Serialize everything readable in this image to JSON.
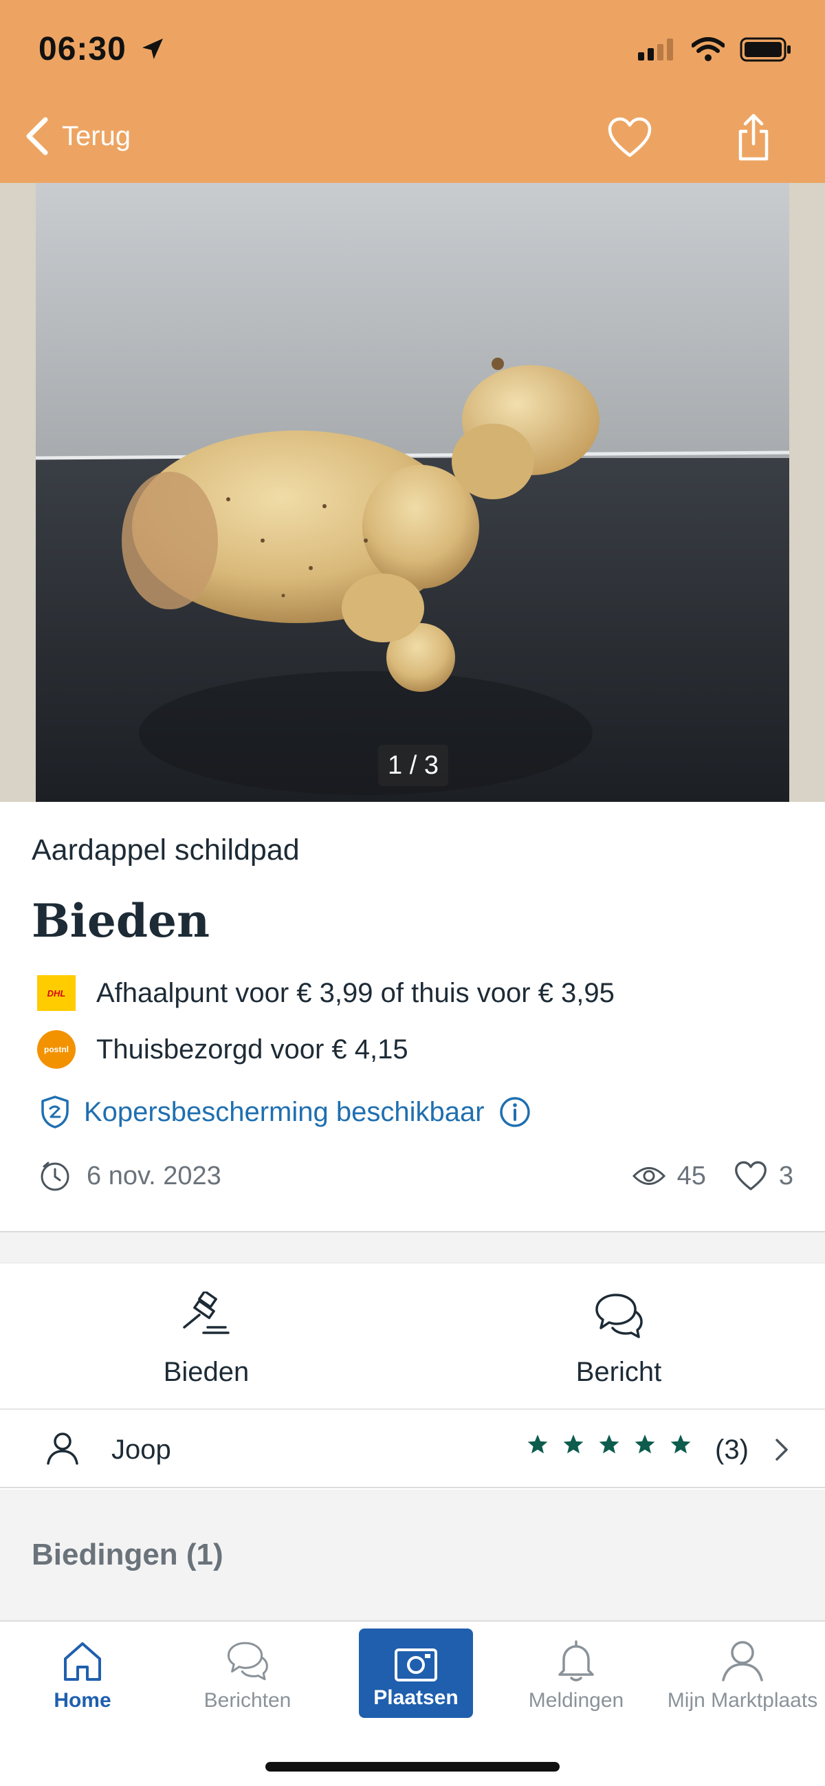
{
  "status_bar": {
    "time": "06:30"
  },
  "nav": {
    "back_label": "Terug"
  },
  "photo": {
    "counter": "1 / 3"
  },
  "listing": {
    "title": "Aardappel schildpad",
    "price": "Bieden",
    "shipping": [
      {
        "carrier": "DHL",
        "logo_text": "DHL",
        "text": "Afhaalpunt voor € 3,99 of thuis voor € 3,95"
      },
      {
        "carrier": "PostNL",
        "logo_text": "postnl",
        "text": "Thuisbezorgd voor € 4,15"
      }
    ],
    "protection": "Kopersbescherming beschikbaar",
    "date": "6 nov. 2023",
    "views": "45",
    "favorites": "3"
  },
  "actions": {
    "bid_label": "Bieden",
    "message_label": "Bericht"
  },
  "seller": {
    "name": "Joop",
    "stars": 5,
    "rating_count": "(3)"
  },
  "bids": {
    "title": "Biedingen (1)"
  },
  "tabs": [
    {
      "label": "Home"
    },
    {
      "label": "Berichten"
    },
    {
      "label": "Plaatsen"
    },
    {
      "label": "Meldingen"
    },
    {
      "label": "Mijn Marktplaats"
    }
  ],
  "colors": {
    "header": "#eda462",
    "accent_blue": "#1f5fae",
    "link_blue": "#1f6fb0",
    "star_green": "#0d5c4d"
  }
}
